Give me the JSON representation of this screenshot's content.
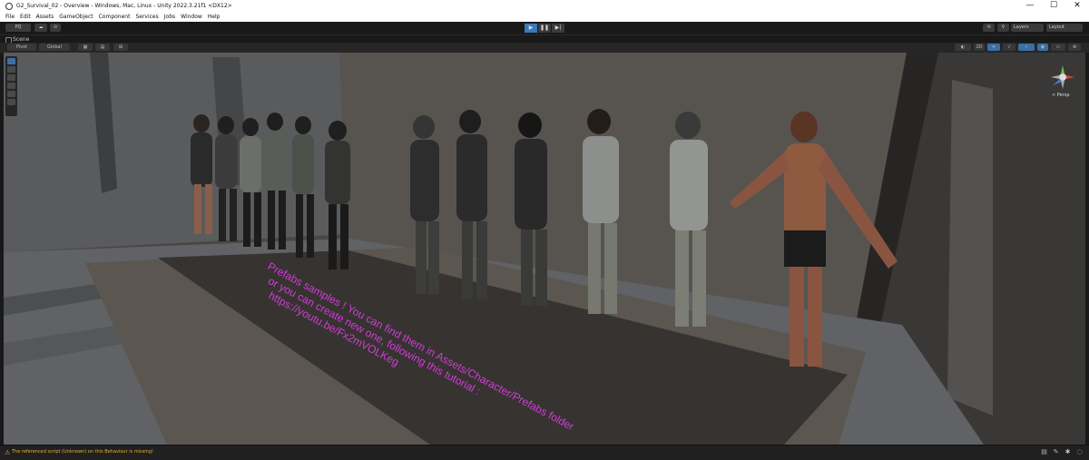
{
  "window": {
    "title": "G2_Survival_02 - Overview - Windows, Mac, Linux - Unity 2022.3.21f1 <DX12>",
    "controls": [
      "—",
      "☐",
      "✕"
    ]
  },
  "menu": [
    "File",
    "Edit",
    "Assets",
    "GameObject",
    "Component",
    "Services",
    "Jobs",
    "Window",
    "Help"
  ],
  "toolbar": {
    "account": "PQ",
    "layers": "Layers",
    "layout": "Layout",
    "play": "▶",
    "pause": "❚❚",
    "step": "▶|"
  },
  "scene_tab": {
    "label": "Scene"
  },
  "scene_tools": {
    "pivot": "Pivot",
    "global": "Global",
    "mode_2d": "2D",
    "persp_label": "< Persp"
  },
  "sign": {
    "line1": "Prefabs samples ! You can find them in Assets/Character/Prefabs folder",
    "line2": "or you can create new one, following this tutorial :",
    "line3": "https://youtu.be/Fx2mVOLKeg"
  },
  "status": {
    "message": "The referenced script (Unknown) on this Behaviour is missing!"
  },
  "colors": {
    "accent": "#3a79bb",
    "sign_text": "#d23cd6",
    "warning": "#e6b130"
  }
}
